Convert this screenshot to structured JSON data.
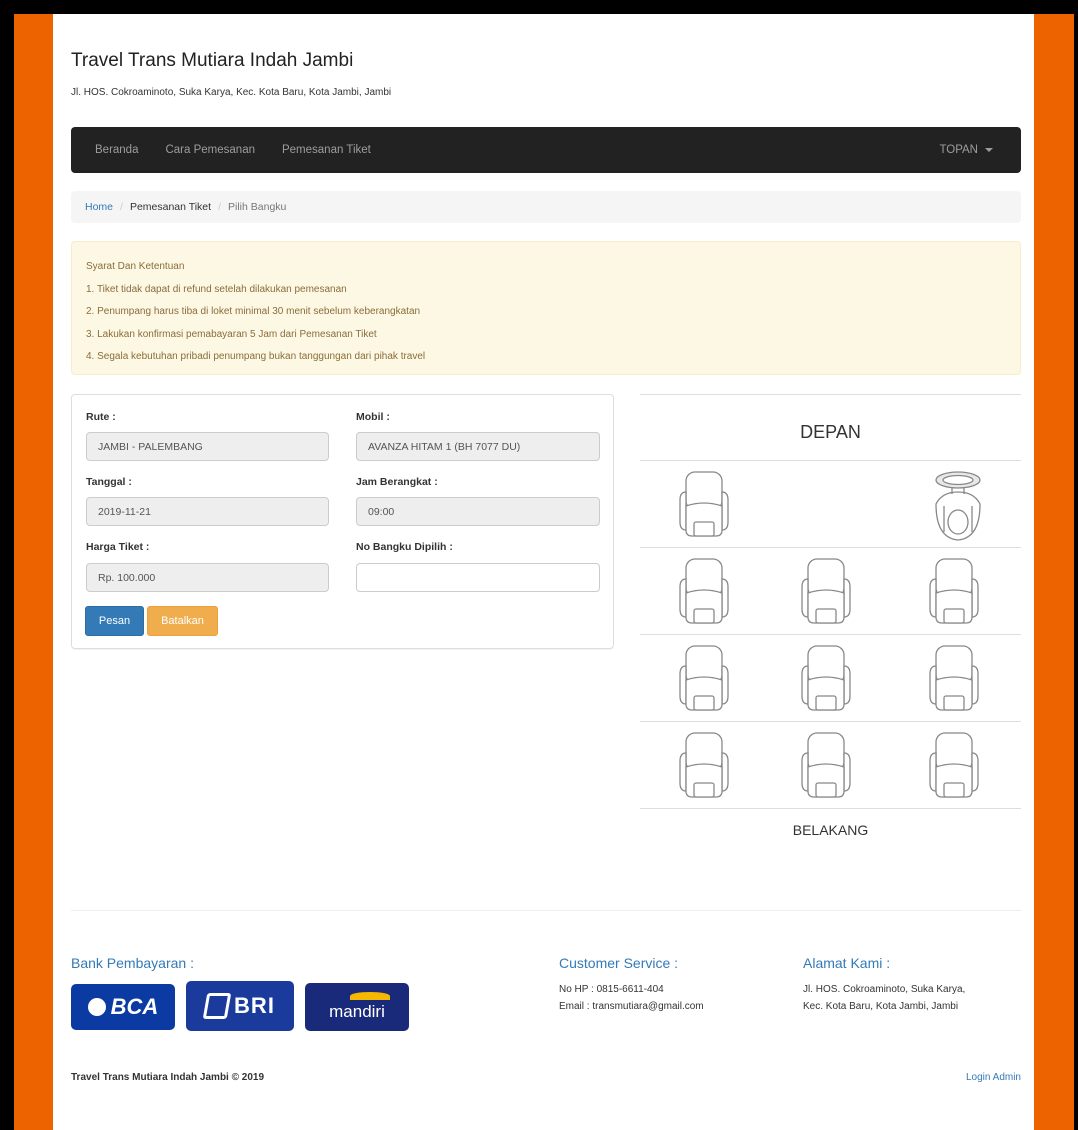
{
  "site": {
    "title": "Travel Trans Mutiara Indah Jambi",
    "address": "Jl. HOS. Cokroaminoto, Suka Karya, Kec. Kota Baru, Kota Jambi, Jambi"
  },
  "nav": {
    "items": [
      "Beranda",
      "Cara Pemesanan",
      "Pemesanan Tiket"
    ],
    "user": "TOPAN"
  },
  "breadcrumb": {
    "home": "Home",
    "middle": "Pemesanan Tiket",
    "active": "Pilih Bangku"
  },
  "terms": {
    "title": "Syarat Dan Ketentuan",
    "items": [
      "1. Tiket tidak dapat di refund setelah dilakukan pemesanan",
      "2. Penumpang harus tiba di loket minimal 30 menit sebelum keberangkatan",
      "3. Lakukan konfirmasi pemabayaran 5 Jam dari Pemesanan Tiket",
      "4. Segala kebutuhan pribadi penumpang bukan tanggungan dari pihak travel"
    ]
  },
  "form": {
    "route_label": "Rute :",
    "route_value": "JAMBI - PALEMBANG",
    "car_label": "Mobil :",
    "car_value": "AVANZA HITAM 1 (BH 7077 DU)",
    "date_label": "Tanggal :",
    "date_value": "2019-11-21",
    "time_label": "Jam Berangkat :",
    "time_value": "09:00",
    "price_label": "Harga Tiket :",
    "price_value": "Rp. 100.000",
    "seat_label": "No Bangku Dipilih :",
    "seat_value": "",
    "order_button": "Pesan",
    "cancel_button": "Batalkan"
  },
  "seatmap": {
    "front": "DEPAN",
    "back": "BELAKANG"
  },
  "footer": {
    "bank_title": "Bank Pembayaran :",
    "banks": [
      "BCA",
      "BRI",
      "mandiri"
    ],
    "cs_title": "Customer Service :",
    "cs_phone": "No HP : 0815-6611-404",
    "cs_email": "Email : transmutiara@gmail.com",
    "address_title": "Alamat Kami :",
    "address_line1": "Jl. HOS. Cokroaminoto, Suka Karya,",
    "address_line2": "Kec. Kota Baru, Kota Jambi, Jambi",
    "copyright": "Travel Trans Mutiara Indah Jambi © 2019",
    "login_admin": "Login Admin"
  },
  "colors": {
    "frame": "#ec6300",
    "navbar": "#222222",
    "primary": "#337ab7",
    "warning": "#f0ad4e"
  }
}
